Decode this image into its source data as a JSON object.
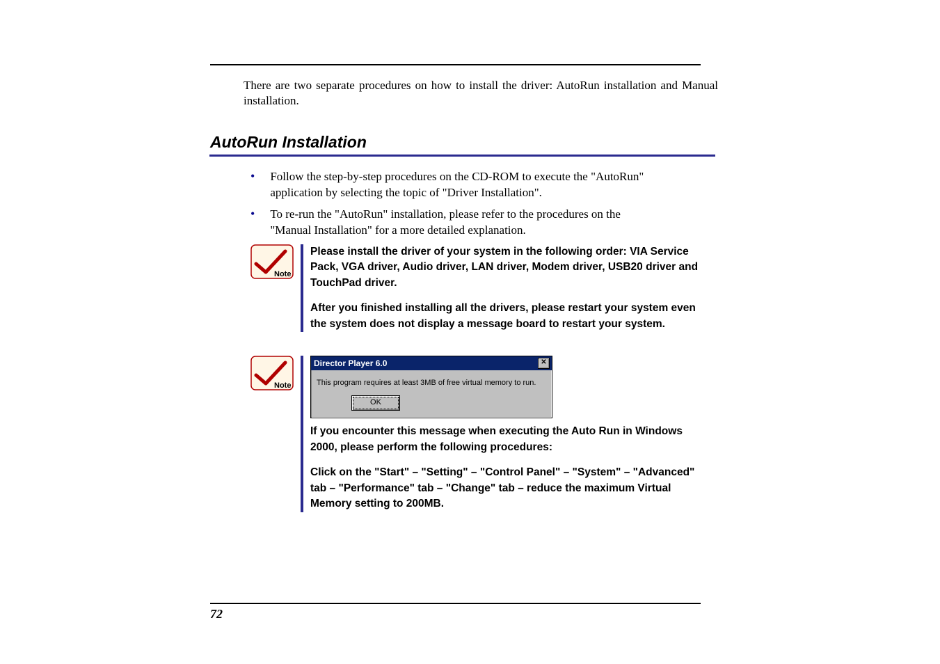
{
  "intro": "There are two separate procedures on how to install the driver: AutoRun installation and Manual installation.",
  "section_title": "AutoRun Installation",
  "bullets": [
    "Follow the step-by-step procedures on the CD-ROM to execute the \"AutoRun\" application by selecting the topic of \"Driver Installation\".",
    "To re-run the \"AutoRun\" installation, please refer to the procedures on the \"Manual Installation\" for a more detailed explanation."
  ],
  "note1": {
    "p1": "Please install the driver of your system in the following order: VIA Service Pack, VGA driver, Audio driver, LAN driver, Modem driver, USB20 driver and TouchPad driver.",
    "p2": "After you finished installing all the drivers, please restart your system even the system does not display a message board to restart your system."
  },
  "dialog": {
    "title": "Director Player 6.0",
    "message": "This program requires at least 3MB of free virtual memory to run.",
    "ok": "OK"
  },
  "note2": {
    "p1": "If you encounter this message when executing the Auto Run  in Windows 2000, please perform the following procedures:",
    "p2": "Click on the \"Start\" – \"Setting\" – \"Control Panel\" – \"System\" – \"Advanced\" tab – \"Performance\" tab – \"Change\" tab – reduce the maximum Virtual Memory setting to 200MB."
  },
  "page_number": "72"
}
